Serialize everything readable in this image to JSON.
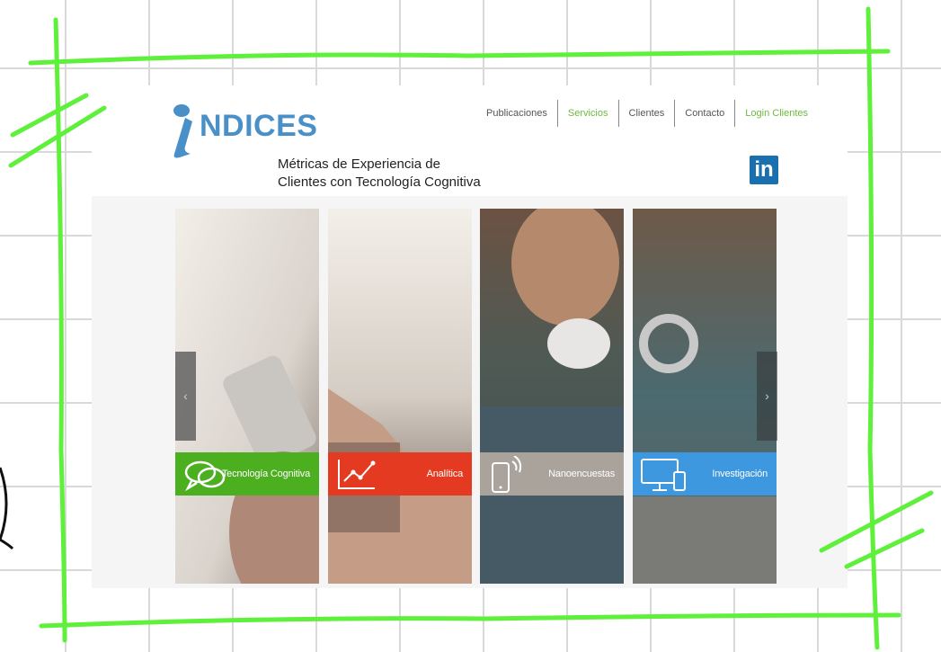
{
  "logo": {
    "text": "NDICES"
  },
  "tagline": [
    "Métricas de Experiencia de",
    "Clientes con Tecnología Cognitiva"
  ],
  "nav": [
    {
      "label": "Publicaciones",
      "active": false
    },
    {
      "label": "Servicios",
      "active": true
    },
    {
      "label": "Clientes",
      "active": false
    },
    {
      "label": "Contacto",
      "active": false
    },
    {
      "label": "Login Clientes",
      "active": true
    }
  ],
  "linkedin": {
    "label": "in"
  },
  "slider": {
    "prev_label": "‹",
    "next_label": "›",
    "panels": [
      {
        "label": "Tecnología Cognitiva",
        "color": "#4caf1f",
        "icon": "chat-bubbles-icon"
      },
      {
        "label": "Analítica",
        "color": "#e43a21",
        "icon": "line-chart-icon"
      },
      {
        "label": "Nanoencuestas",
        "color": "#a9a39c",
        "icon": "mobile-signal-icon"
      },
      {
        "label": "Investigación",
        "color": "#3d98df",
        "icon": "devices-icon"
      }
    ]
  },
  "colors": {
    "accent_green": "#6dbb3c",
    "frame_green": "#5ef03a",
    "linkedin_blue": "#1a6fae"
  }
}
